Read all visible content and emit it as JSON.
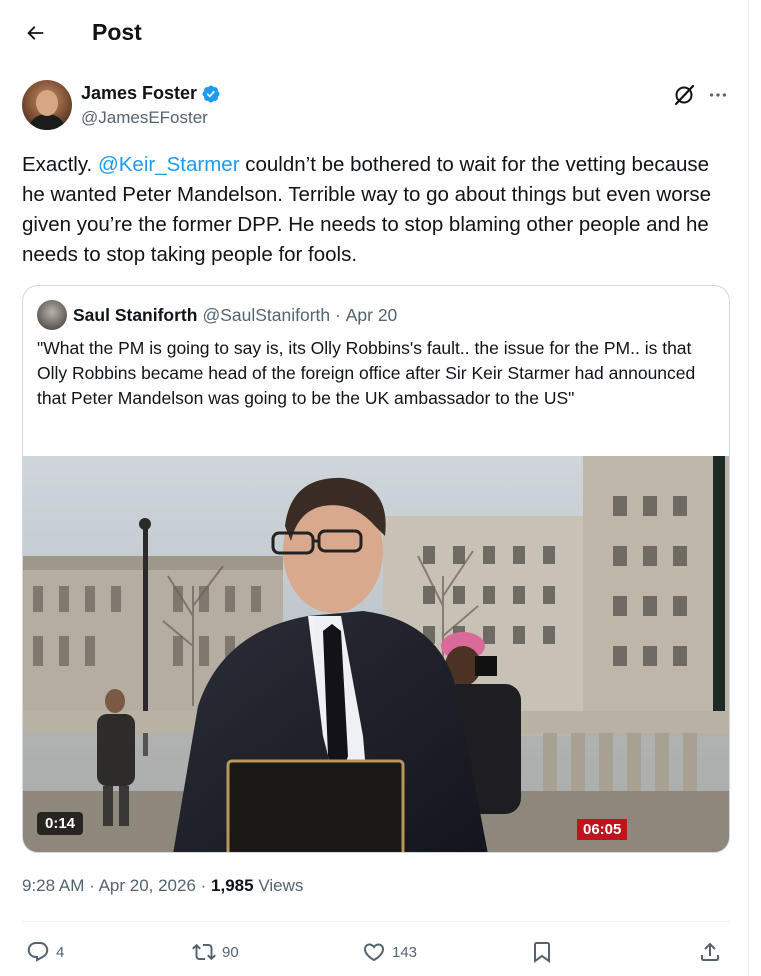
{
  "header": {
    "title": "Post"
  },
  "post": {
    "author_name": "James Foster",
    "author_handle": "@JamesEFoster",
    "text_before": "Exactly. ",
    "mention": "@Keir_Starmer",
    "text_after": " couldn’t be bothered to wait for the vetting because he wanted Peter Mandelson.  Terrible way to go about things but even worse given you’re the former DPP.  He needs to stop blaming other people and he needs to stop taking people for fools.",
    "time": "9:28 AM",
    "date": "Apr 20, 2026",
    "views_count": "1,985",
    "views_label": "Views"
  },
  "quote": {
    "author_name": "Saul Staniforth",
    "author_handle": "@SaulStaniforth",
    "date": "Apr 20",
    "text": "\"What the PM is going to say is, its Olly Robbins's fault.. the issue for the PM.. is that Olly Robbins became head of the foreign office after Sir Keir Starmer had announced that Peter Mandelson was going to be the UK ambassador to the US\"",
    "video_duration": "0:14",
    "broadcast_clock": "06:05"
  },
  "actions": {
    "replies": "4",
    "reposts": "90",
    "likes": "143"
  },
  "icons": {
    "back": "arrow-left-icon",
    "verified": "verified-badge-icon",
    "grok": "grok-icon",
    "more": "more-horizontal-icon",
    "reply": "reply-icon",
    "repost": "repost-icon",
    "like": "heart-icon",
    "bookmark": "bookmark-icon",
    "share": "share-icon"
  },
  "colors": {
    "accent": "#1d9bf0",
    "text": "#0f1419",
    "secondary": "#536471",
    "border": "#cfd9de"
  }
}
